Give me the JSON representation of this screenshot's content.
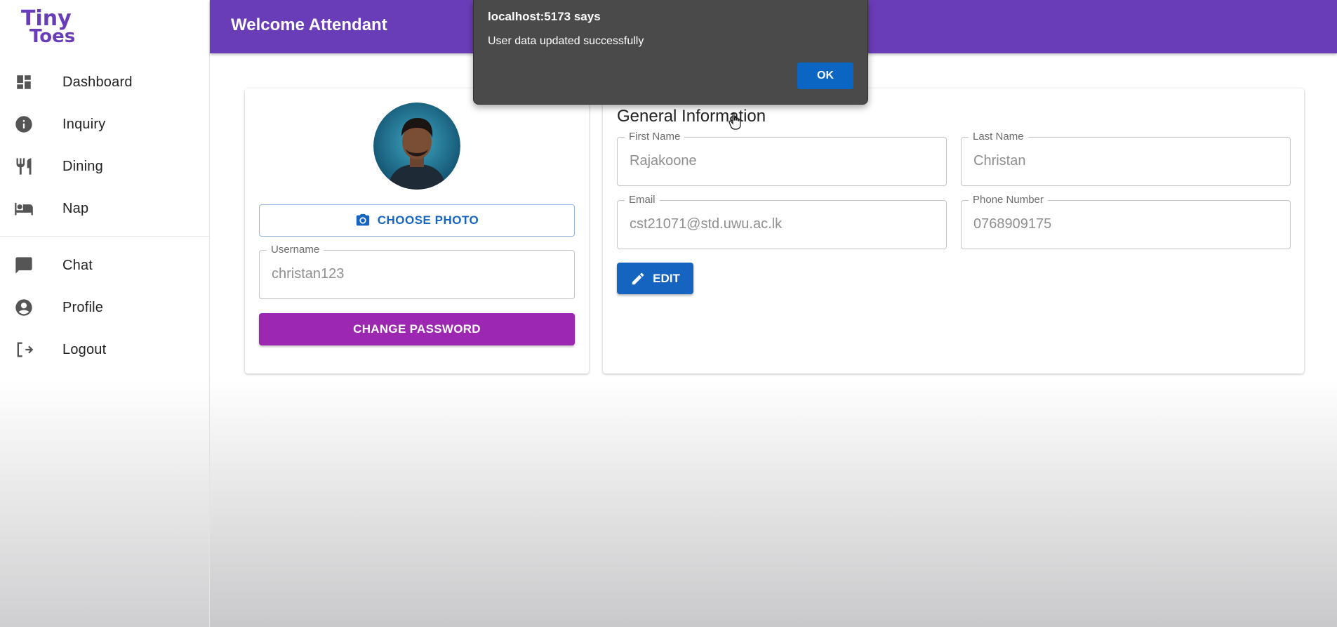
{
  "app": {
    "logo_text_1": "Tiny",
    "logo_text_2": "Toes",
    "brand_color": "#6a3db8"
  },
  "sidebar": {
    "items": [
      {
        "label": "Dashboard",
        "icon": "dashboard-icon"
      },
      {
        "label": "Inquiry",
        "icon": "info-icon"
      },
      {
        "label": "Dining",
        "icon": "restaurant-icon"
      },
      {
        "label": "Nap",
        "icon": "bed-icon"
      },
      {
        "label": "Chat",
        "icon": "chat-icon"
      },
      {
        "label": "Profile",
        "icon": "account-circle-icon"
      },
      {
        "label": "Logout",
        "icon": "logout-icon"
      }
    ]
  },
  "header": {
    "title": "Welcome Attendant"
  },
  "profile_card": {
    "choose_photo_label": "CHOOSE PHOTO",
    "username_label": "Username",
    "username_value": "christan123",
    "change_password_label": "CHANGE PASSWORD"
  },
  "general_info": {
    "title": "General Information",
    "first_name_label": "First Name",
    "first_name_value": "Rajakoone",
    "last_name_label": "Last Name",
    "last_name_value": "Christan",
    "email_label": "Email",
    "email_value": "cst21071@std.uwu.ac.lk",
    "phone_label": "Phone Number",
    "phone_value": "0768909175",
    "edit_label": "EDIT"
  },
  "alert": {
    "title": "localhost:5173 says",
    "message": "User data updated successfully",
    "ok_label": "OK"
  },
  "colors": {
    "header": "#6a3db8",
    "primary": "#1565c0",
    "secondary": "#9c27b0",
    "dialog": "#4a4a4a"
  }
}
